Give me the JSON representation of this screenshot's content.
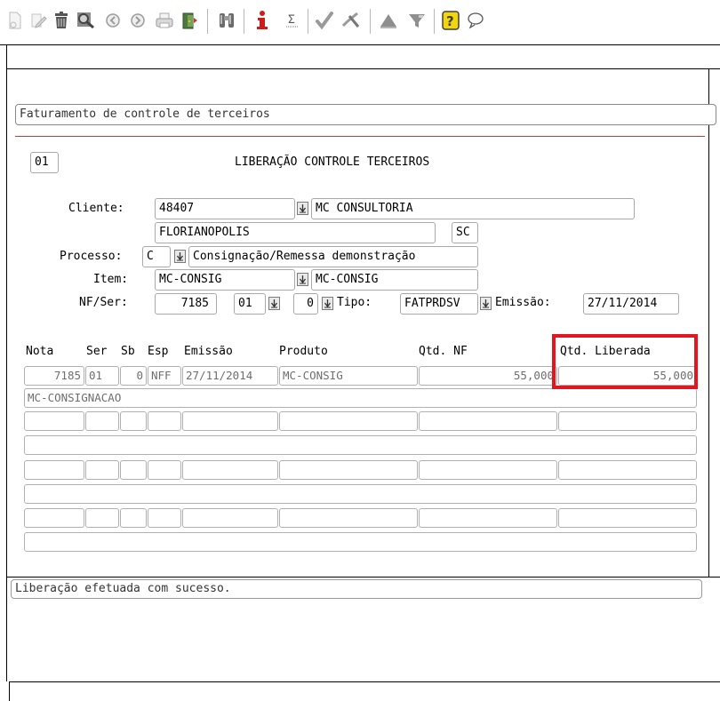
{
  "header": {
    "title": "Faturamento de controle de terceiros"
  },
  "form": {
    "code": "01",
    "title": "LIBERAÇÃO CONTROLE TERCEIROS",
    "cliente_label": "Cliente:",
    "cliente_code": "48407",
    "cliente_name": "MC CONSULTORIA",
    "cidade": "FLORIANOPOLIS",
    "uf": "SC",
    "processo_label": "Processo:",
    "processo_code": "C",
    "processo_desc": "Consignação/Remessa demonstração",
    "item_label": "Item:",
    "item_code": "MC-CONSIG",
    "item_desc": "MC-CONSIG",
    "nfser_label": "NF/Ser:",
    "nf": "7185",
    "serie": "01",
    "subserie": "0",
    "tipo_label": "Tipo:",
    "tipo": "FATPRDSV",
    "emissao_label": "Emissão:",
    "emissao": "27/11/2014"
  },
  "table": {
    "headers": [
      "Nota",
      "Ser",
      "Sb",
      "Esp",
      "Emissão",
      "Produto",
      "Qtd. NF",
      "Qtd. Liberada"
    ],
    "row": {
      "nota": "7185",
      "ser": "01",
      "sb": "0",
      "esp": "NFF",
      "emissao": "27/11/2014",
      "produto": "MC-CONSIG",
      "qtd_nf": "55,000",
      "qtd_liberada": "55,000",
      "descricao": "MC-CONSIGNACAO"
    }
  },
  "status": {
    "message": "Liberação efetuada com sucesso."
  },
  "colors": {
    "highlight": "#e3151f",
    "divider": "#e03030",
    "help": "#f2d50c",
    "info": "#c81e1e"
  },
  "toolbar_icons": [
    "new-doc-icon",
    "edit-icon",
    "delete-icon",
    "search-icon",
    "previous-icon",
    "next-icon",
    "print-icon",
    "exit-icon",
    "binoculars-icon",
    "info-icon",
    "counter-icon",
    "check-icon",
    "cancel-icon",
    "up-icon",
    "filter-icon",
    "help-icon",
    "chat-icon"
  ]
}
